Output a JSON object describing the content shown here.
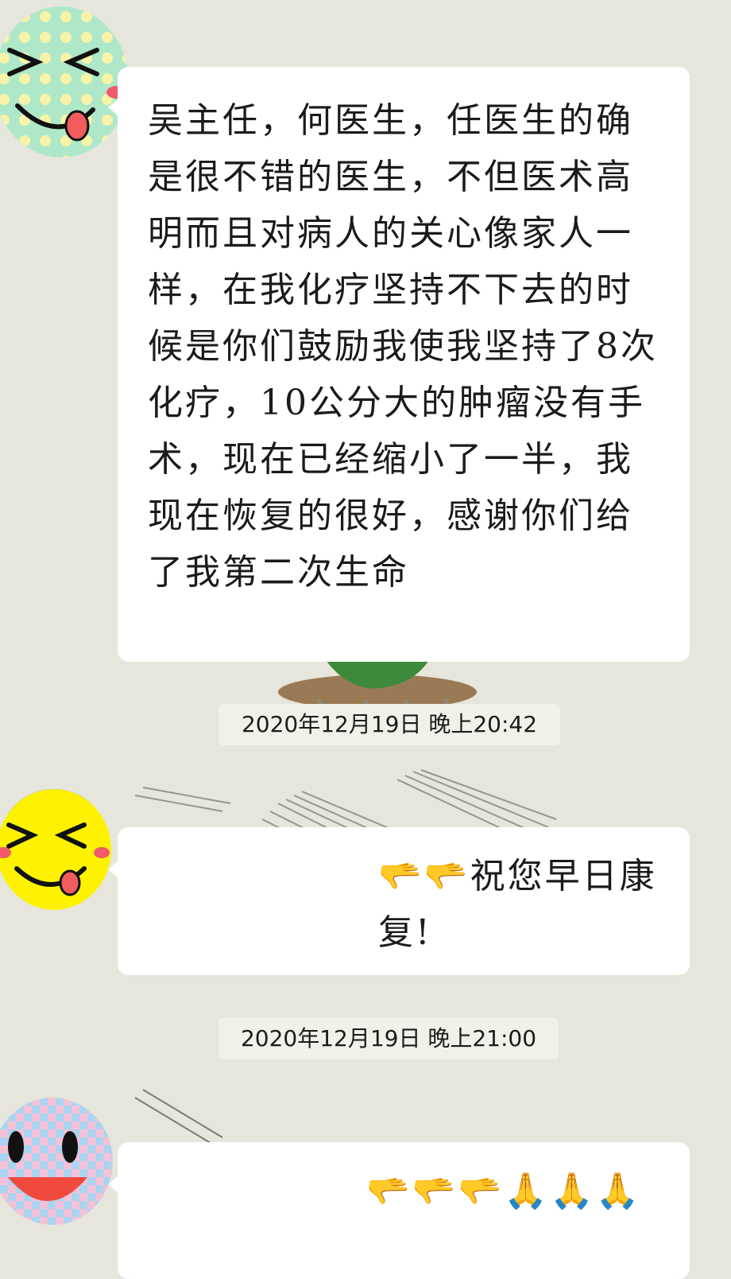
{
  "messages": [
    {
      "text": "吴主任，何医生，任医生的确是很不错的医生，不但医术高明而且对病人的关心像家人一样，在我化疗坚持不下去的时候是你们鼓励我使我坚持了8次化疗，10公分大的肿瘤没有手术，现在已经缩小了一半，我现在恢复的很好，感谢你们给了我第二次生命"
    },
    {
      "timestamp": "2020年12月19日 晚上20:42",
      "prefix_emoji": "🫳🫳",
      "text": "祝您早日康复!"
    },
    {
      "timestamp": "2020年12月19日 晚上21:00",
      "emoji": "🫳🫳🫳🙏🙏🙏"
    }
  ],
  "colors": {
    "background": "#e6e6dc",
    "bubble": "#ffffff",
    "text": "#1b1b1b",
    "timestamp_bg": "#f1f1ea"
  },
  "icons": [
    "green-dotted-smiley-avatar",
    "yellow-smiley-avatar",
    "pink-checkered-smiley-avatar"
  ]
}
